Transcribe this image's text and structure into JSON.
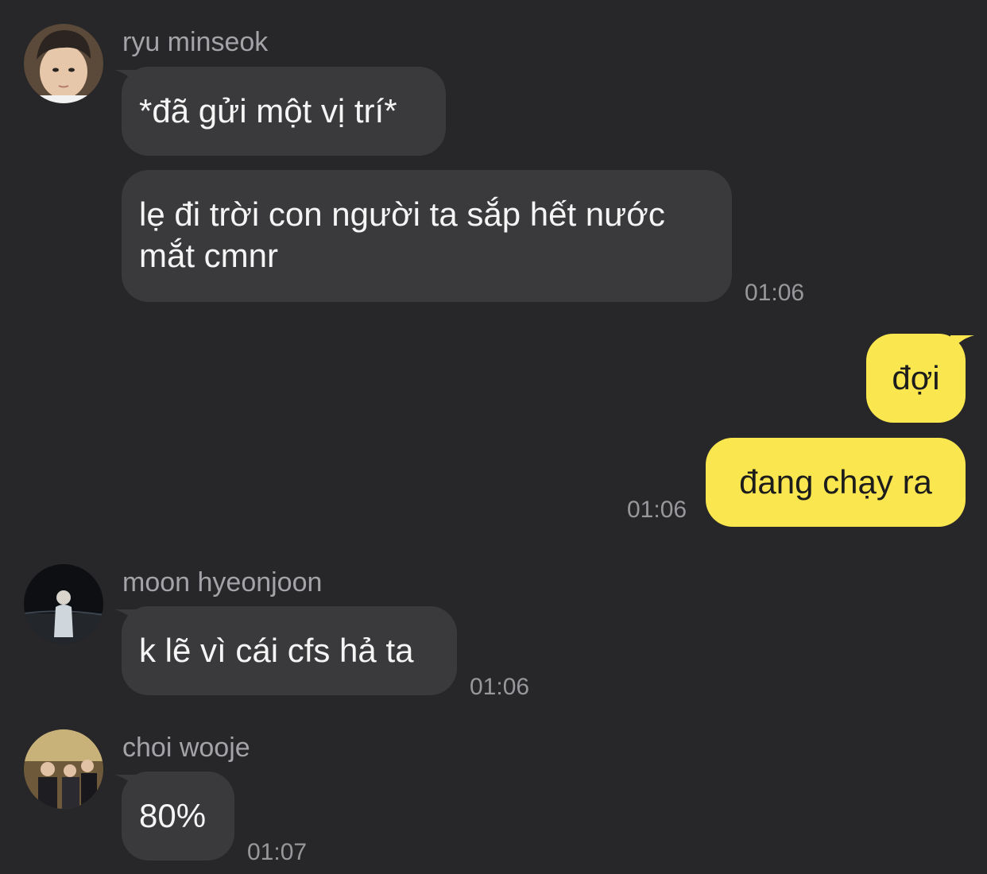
{
  "messages": [
    {
      "sender": "ryu minseok",
      "avatar_icon": "user-avatar-icon",
      "bubbles": [
        "*đã gửi một vị trí*",
        "lẹ đi trời con người ta sắp hết nước mắt cmnr"
      ],
      "time": "01:06"
    },
    {
      "sender": "me",
      "bubbles": [
        "đợi",
        "đang chạy ra"
      ],
      "time": "01:06"
    },
    {
      "sender": "moon hyeonjoon",
      "avatar_icon": "user-avatar-icon",
      "bubbles": [
        "k lẽ vì cái cfs hả ta"
      ],
      "time": "01:06"
    },
    {
      "sender": "choi wooje",
      "avatar_icon": "user-avatar-icon",
      "bubbles": [
        "80%"
      ],
      "time": "01:07"
    }
  ],
  "colors": {
    "background": "#272729",
    "incoming_bubble": "#3a3a3c",
    "outgoing_bubble": "#fae64e",
    "text_light": "#f5f5f5",
    "meta_text": "#a4a4a8"
  }
}
